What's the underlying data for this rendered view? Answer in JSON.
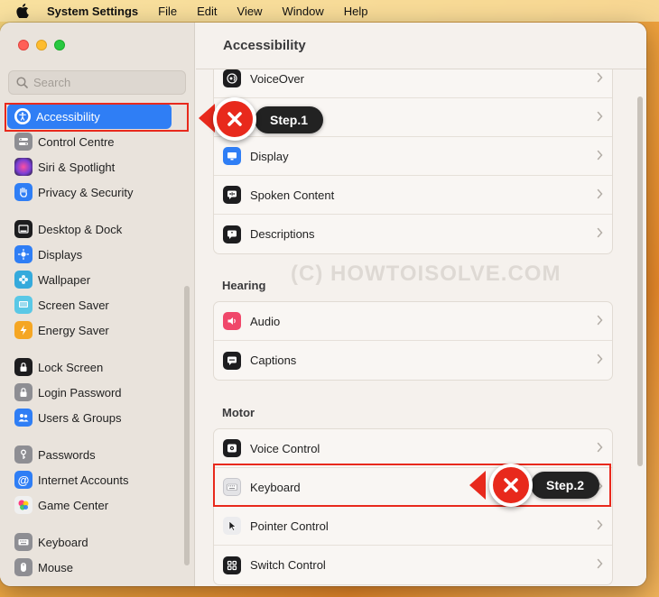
{
  "menubar": {
    "app_name": "System Settings",
    "items": [
      "File",
      "Edit",
      "View",
      "Window",
      "Help"
    ]
  },
  "sidebar": {
    "search_placeholder": "Search",
    "items": [
      {
        "label": "Accessibility",
        "icon": "accessibility-icon",
        "color": "#2f7ef5",
        "selected": true
      },
      {
        "label": "Control Centre",
        "icon": "control-centre-icon",
        "color": "#8e8e93"
      },
      {
        "label": "Siri & Spotlight",
        "icon": "siri-icon",
        "color": "#7a3fd6"
      },
      {
        "label": "Privacy & Security",
        "icon": "hand-icon",
        "color": "#2f7ef5"
      },
      {
        "label": "Desktop & Dock",
        "icon": "dock-icon",
        "color": "#1d1d1f"
      },
      {
        "label": "Displays",
        "icon": "sun-icon",
        "color": "#2f7ef5"
      },
      {
        "label": "Wallpaper",
        "icon": "flower-icon",
        "color": "#35aadc"
      },
      {
        "label": "Screen Saver",
        "icon": "screen-saver-icon",
        "color": "#5ac8e6"
      },
      {
        "label": "Energy Saver",
        "icon": "battery-icon",
        "color": "#f5a623"
      },
      {
        "label": "Lock Screen",
        "icon": "lock-icon",
        "color": "#1d1d1f"
      },
      {
        "label": "Login Password",
        "icon": "padlock-icon",
        "color": "#8e8e93"
      },
      {
        "label": "Users & Groups",
        "icon": "users-icon",
        "color": "#2f7ef5"
      },
      {
        "label": "Passwords",
        "icon": "key-icon",
        "color": "#8e8e93"
      },
      {
        "label": "Internet Accounts",
        "icon": "at-icon",
        "color": "#2f7ef5"
      },
      {
        "label": "Game Center",
        "icon": "game-center-icon",
        "color": "#f0f0f0"
      },
      {
        "label": "Keyboard",
        "icon": "keyboard-icon",
        "color": "#8e8e93"
      },
      {
        "label": "Mouse",
        "icon": "mouse-icon",
        "color": "#8e8e93"
      }
    ]
  },
  "main": {
    "title": "Accessibility",
    "vision_rows": [
      {
        "label": "VoiceOver",
        "icon": "voiceover-icon",
        "color": "#1d1d1f"
      },
      {
        "label": "",
        "icon": "zoom-icon",
        "color": "#1d1d1f"
      },
      {
        "label": "Display",
        "icon": "display-icon",
        "color": "#2f7ef5"
      },
      {
        "label": "Spoken Content",
        "icon": "spoken-content-icon",
        "color": "#1d1d1f"
      },
      {
        "label": "Descriptions",
        "icon": "descriptions-icon",
        "color": "#1d1d1f"
      }
    ],
    "hearing_title": "Hearing",
    "hearing_rows": [
      {
        "label": "Audio",
        "icon": "audio-icon",
        "color": "#f0476a"
      },
      {
        "label": "Captions",
        "icon": "captions-icon",
        "color": "#1d1d1f"
      }
    ],
    "motor_title": "Motor",
    "motor_rows": [
      {
        "label": "Voice Control",
        "icon": "voice-control-icon",
        "color": "#1d1d1f"
      },
      {
        "label": "Keyboard",
        "icon": "keyboard-icon",
        "color": "#c7c7cc"
      },
      {
        "label": "Pointer Control",
        "icon": "pointer-icon",
        "color": "#d8d8dc"
      },
      {
        "label": "Switch Control",
        "icon": "switch-control-icon",
        "color": "#1d1d1f"
      }
    ]
  },
  "watermark": "(C) HOWTOISOLVE.COM",
  "annotations": {
    "step1": "Step.1",
    "step2": "Step.2",
    "accent": "#e8291c"
  }
}
